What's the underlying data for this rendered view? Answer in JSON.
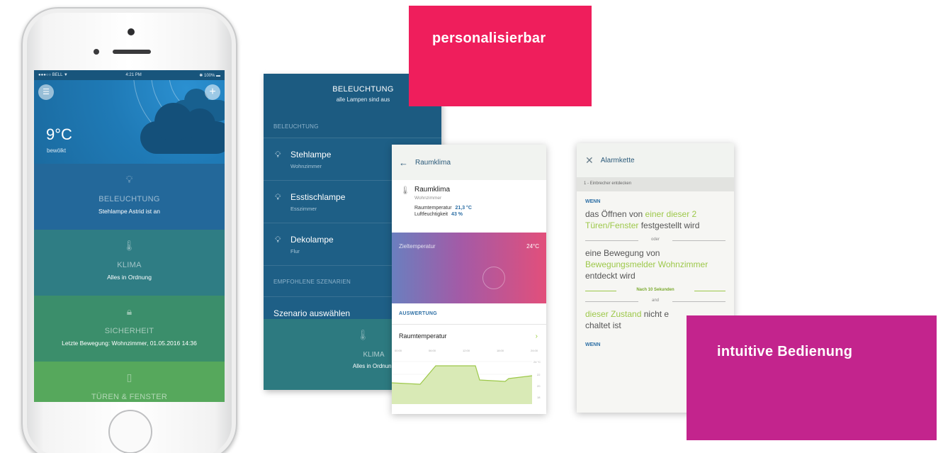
{
  "phone": {
    "statusbar": {
      "carrier": "●●●○○ BELL ▼",
      "time": "4:21 PM",
      "battery": "✱ 100% ▬"
    },
    "weather": {
      "temperature": "9°C",
      "condition": "bewölkt"
    },
    "tiles": [
      {
        "title": "BELEUCHTUNG",
        "subtitle": "Stehlampe Astrid ist an"
      },
      {
        "title": "KLIMA",
        "subtitle": "Alles in Ordnung"
      },
      {
        "title": "SICHERHEIT",
        "subtitle": "Letzte Bewegung: Wohnzimmer, 01.05.2016 14:36"
      },
      {
        "title": "TÜREN & FENSTER",
        "subtitle": ""
      }
    ]
  },
  "lighting": {
    "title": "BELEUCHTUNG",
    "subtitle": "alle Lampen sind aus",
    "section_label": "BELEUCHTUNG",
    "items": [
      {
        "name": "Stehlampe",
        "room": "Wohnzimmer"
      },
      {
        "name": "Esstischlampe",
        "room": "Esszimmer"
      },
      {
        "name": "Dekolampe",
        "room": "Flur"
      }
    ],
    "scenarios_label": "EMPFOHLENE SZENARIEN",
    "scenario_button": "Szenario auswählen",
    "klima": {
      "title": "KLIMA",
      "subtitle": "Alles in Ordnung"
    }
  },
  "climate": {
    "header": "Raumklima",
    "device": {
      "name": "Raumklima",
      "room": "Wohnzimmer"
    },
    "temperature_label": "Raumtemperatur",
    "temperature_value": "21,3 °C",
    "humidity_label": "Luftfeuchtigkeit",
    "humidity_value": "43 %",
    "target_label": "Zieltemperatur",
    "target_value": "24°C",
    "section_label": "AUSWERTUNG",
    "chart_row_label": "Raumtemperatur",
    "chart_times": [
      "00:00",
      "06:00",
      "12:00",
      "18:00",
      "24:00"
    ],
    "chart_values_label": [
      "24 °C",
      "22",
      "20",
      "18"
    ]
  },
  "alarm": {
    "header": "Alarmkette",
    "step": "1 - Einbrecher entdecken",
    "wenn": "WENN",
    "cond1_a": "das Öffnen von ",
    "cond1_hl": "einer dieser 2 Türen/Fenster",
    "cond1_b": " festgestellt wird",
    "oder": "oder",
    "cond2_a": "eine Bewegung von ",
    "cond2_hl": "Bewegungsmelder Wohnzimmer",
    "cond2_b": " entdeckt wird",
    "delay": "Nach 10 Sekunden",
    "and": "and",
    "cond3_hl": "dieser Zustand",
    "cond3_b": " nicht e",
    "cond3_c": "chaltet ist",
    "wenn2": "WENN"
  },
  "badges": {
    "personalisierbar": "personalisierbar",
    "intuitive": "intuitive Bedienung"
  },
  "colors": {
    "pink": "#ef1e5c",
    "magenta": "#c3248d",
    "accent_green": "#9dc84a",
    "accent_blue": "#2d6fa5"
  }
}
